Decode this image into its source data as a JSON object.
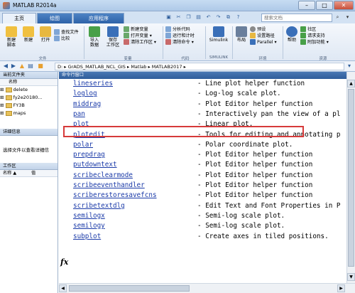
{
  "window": {
    "title": "MATLAB R2014a"
  },
  "tabs": [
    "主页",
    "绘图",
    "应用程序"
  ],
  "search": {
    "placeholder": "搜索文档"
  },
  "ribbon": {
    "file_buttons": [
      {
        "label": "新建\n脚本",
        "color": "#f0c040"
      },
      {
        "label": "新建",
        "color": "#f0c040"
      },
      {
        "label": "打开",
        "color": "#e8b840"
      }
    ],
    "file_small": [
      "查找文件",
      "比较"
    ],
    "var_buttons": [
      {
        "label": "导入\n数据",
        "color": "#48a048"
      },
      {
        "label": "保存\n工作区",
        "color": "#3a6fb8"
      }
    ],
    "var_small": [
      "新建变量",
      "打开变量 ▾",
      "清除工作区 ▾"
    ],
    "code_small": [
      "分析代码",
      "运行和计时",
      "清除命令 ▾"
    ],
    "simulink": {
      "label": "Simulink",
      "color": "#3a6fb8"
    },
    "layout": {
      "label": "布局",
      "color": "#6a7f9c"
    },
    "env_small": [
      "预设",
      "设置路径",
      "Parallel ▾"
    ],
    "help": {
      "label": "帮助",
      "color": "#3a6fb8"
    },
    "resources_small": [
      "社区",
      "请求支持",
      "附加功能 ▾"
    ],
    "sections": [
      "文件",
      "变量",
      "代码",
      "SIMULINK",
      "环境",
      "资源"
    ]
  },
  "address": {
    "path": "D: ▸ GrADS_MATLAB_NCL_GIS ▸ Matlab ▸ MATLAB2017 ▸"
  },
  "current_folder": {
    "title": "当前文件夹",
    "column": "名称",
    "items": [
      "delete",
      "fy2e20180...",
      "FY3B",
      "maps"
    ]
  },
  "details": {
    "title": "详细信息",
    "message": "选择文件以查看详细信"
  },
  "workspace": {
    "title": "工作区",
    "col_name": "名称 ▲",
    "col_value": "值"
  },
  "command_window": {
    "title": "命令行窗口",
    "rows": [
      {
        "fn": "lineseries",
        "desc": "- Line plot helper function"
      },
      {
        "fn": "loglog",
        "desc": "- Log-log scale plot."
      },
      {
        "fn": "middrag",
        "desc": "- Plot Editor helper function"
      },
      {
        "fn": "pan",
        "desc": "- Interactively pan the view of a pl"
      },
      {
        "fn": "plot",
        "desc": "- Linear plot."
      },
      {
        "fn": "plotedit",
        "desc": "- Tools for editing and annotating p"
      },
      {
        "fn": "polar",
        "desc": "- Polar coordinate plot."
      },
      {
        "fn": "prepdrag",
        "desc": "- Plot Editor helper function"
      },
      {
        "fn": "putdowntext",
        "desc": "- Plot Editor helper function"
      },
      {
        "fn": "scribeclearmode",
        "desc": "- Plot Editor helper function"
      },
      {
        "fn": "scribeeventhandler",
        "desc": "- Plot Editor helper function"
      },
      {
        "fn": "scriberestoresavefcns",
        "desc": "- Plot Editor helper function"
      },
      {
        "fn": "scribetextdlg",
        "desc": "- Edit Text and Font Properties in P"
      },
      {
        "fn": "semilogx",
        "desc": "- Semi-log scale plot."
      },
      {
        "fn": "semilogy",
        "desc": "- Semi-log scale plot."
      },
      {
        "fn": "subplot",
        "desc": "- Create axes in tiled positions."
      }
    ],
    "prompt_icon": "fx"
  },
  "colors": {
    "highlight": "#d63a3a",
    "link": "#1a3aa8"
  }
}
